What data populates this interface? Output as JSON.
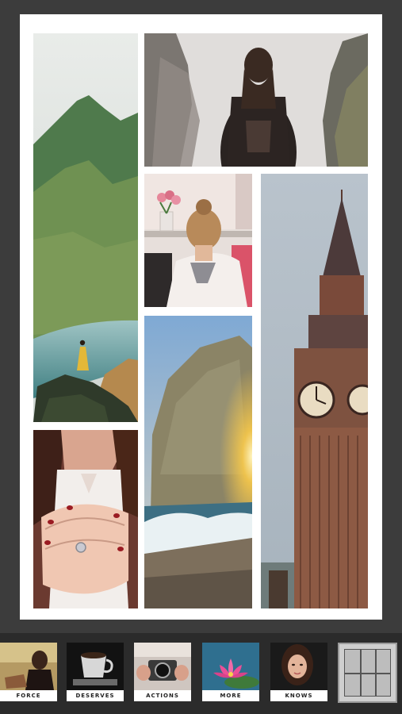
{
  "collage": {
    "background_color": "#ffffff",
    "cells": [
      {
        "name": "cell-mountain-lake",
        "subject": "woman in yellow dress on rocks by lake with green mountain"
      },
      {
        "name": "cell-foggy-cliffs",
        "subject": "woman with backpack facing foggy cliffs"
      },
      {
        "name": "cell-woman-bun",
        "subject": "woman with hair bun from behind, flowers on shelf"
      },
      {
        "name": "cell-big-ben",
        "subject": "Big Ben clock tower"
      },
      {
        "name": "cell-sea-rock",
        "subject": "rock cliff at sunset by the sea"
      },
      {
        "name": "cell-hands-ring",
        "subject": "hands with red nails and ring"
      }
    ]
  },
  "tray": {
    "thumbnails": [
      {
        "label": "FORCE",
        "icon": "woman-sitting-photo"
      },
      {
        "label": "DESERVES",
        "icon": "coffee-cup-photo"
      },
      {
        "label": "ACTIONS",
        "icon": "camera-photo"
      },
      {
        "label": "MORE",
        "icon": "lotus-flower-photo"
      },
      {
        "label": "KNOWS",
        "icon": "portrait-photo"
      }
    ],
    "layout_button": {
      "icon": "grid-layout-icon"
    }
  },
  "colors": {
    "editor_bg": "#3c3c3c",
    "tray_bg": "#2b2b2b",
    "label_bg": "#ffffff"
  }
}
